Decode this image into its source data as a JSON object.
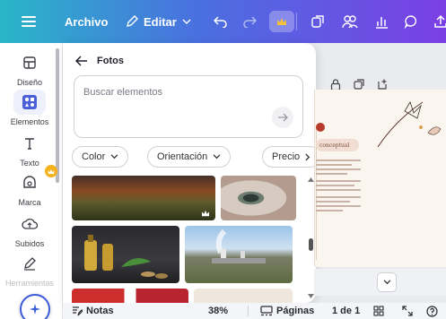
{
  "topbar": {
    "file_label": "Archivo",
    "edit_label": "Editar",
    "brand_colors": [
      "#29b6c8",
      "#4a6fe0",
      "#7b3fe4"
    ],
    "icons": [
      "menu-icon",
      "pencil-icon",
      "chevron-down-icon",
      "undo-icon",
      "redo-icon",
      "crown-icon",
      "resize-icon",
      "collaborators-icon",
      "insights-icon",
      "comment-icon",
      "share-icon"
    ]
  },
  "sidebar": {
    "items": [
      {
        "label": "Diseño",
        "icon": "layout-icon"
      },
      {
        "label": "Elementos",
        "icon": "shapes-icon",
        "active": true
      },
      {
        "label": "Texto",
        "icon": "text-icon"
      },
      {
        "label": "Marca",
        "icon": "brand-icon",
        "premium": true
      },
      {
        "label": "Subidos",
        "icon": "cloud-upload-icon"
      },
      {
        "label": "Herramientas",
        "icon": "pen-icon"
      }
    ],
    "magic_icon": "magic-icon"
  },
  "panel": {
    "title": "Fotos",
    "search_placeholder": "Buscar elementos",
    "filters": [
      "Color",
      "Orientación",
      "Precio"
    ],
    "photos": [
      {
        "subject": "autumn-forest",
        "premium": true
      },
      {
        "subject": "eye-closeup",
        "premium": false
      },
      {
        "subject": "bottles-and-coins",
        "premium": false
      },
      {
        "subject": "industrial-plant",
        "premium": false
      },
      {
        "subject": "flag",
        "premium": false
      },
      {
        "subject": "light-photo",
        "premium": false
      }
    ]
  },
  "canvas": {
    "title_fragment": "conceptual",
    "tools": [
      "lock-icon",
      "duplicate-icon",
      "add-page-icon"
    ]
  },
  "bottombar": {
    "notes_label": "Notas",
    "zoom": "38%",
    "pages_label": "Páginas",
    "page_counter": "1 de 1"
  }
}
